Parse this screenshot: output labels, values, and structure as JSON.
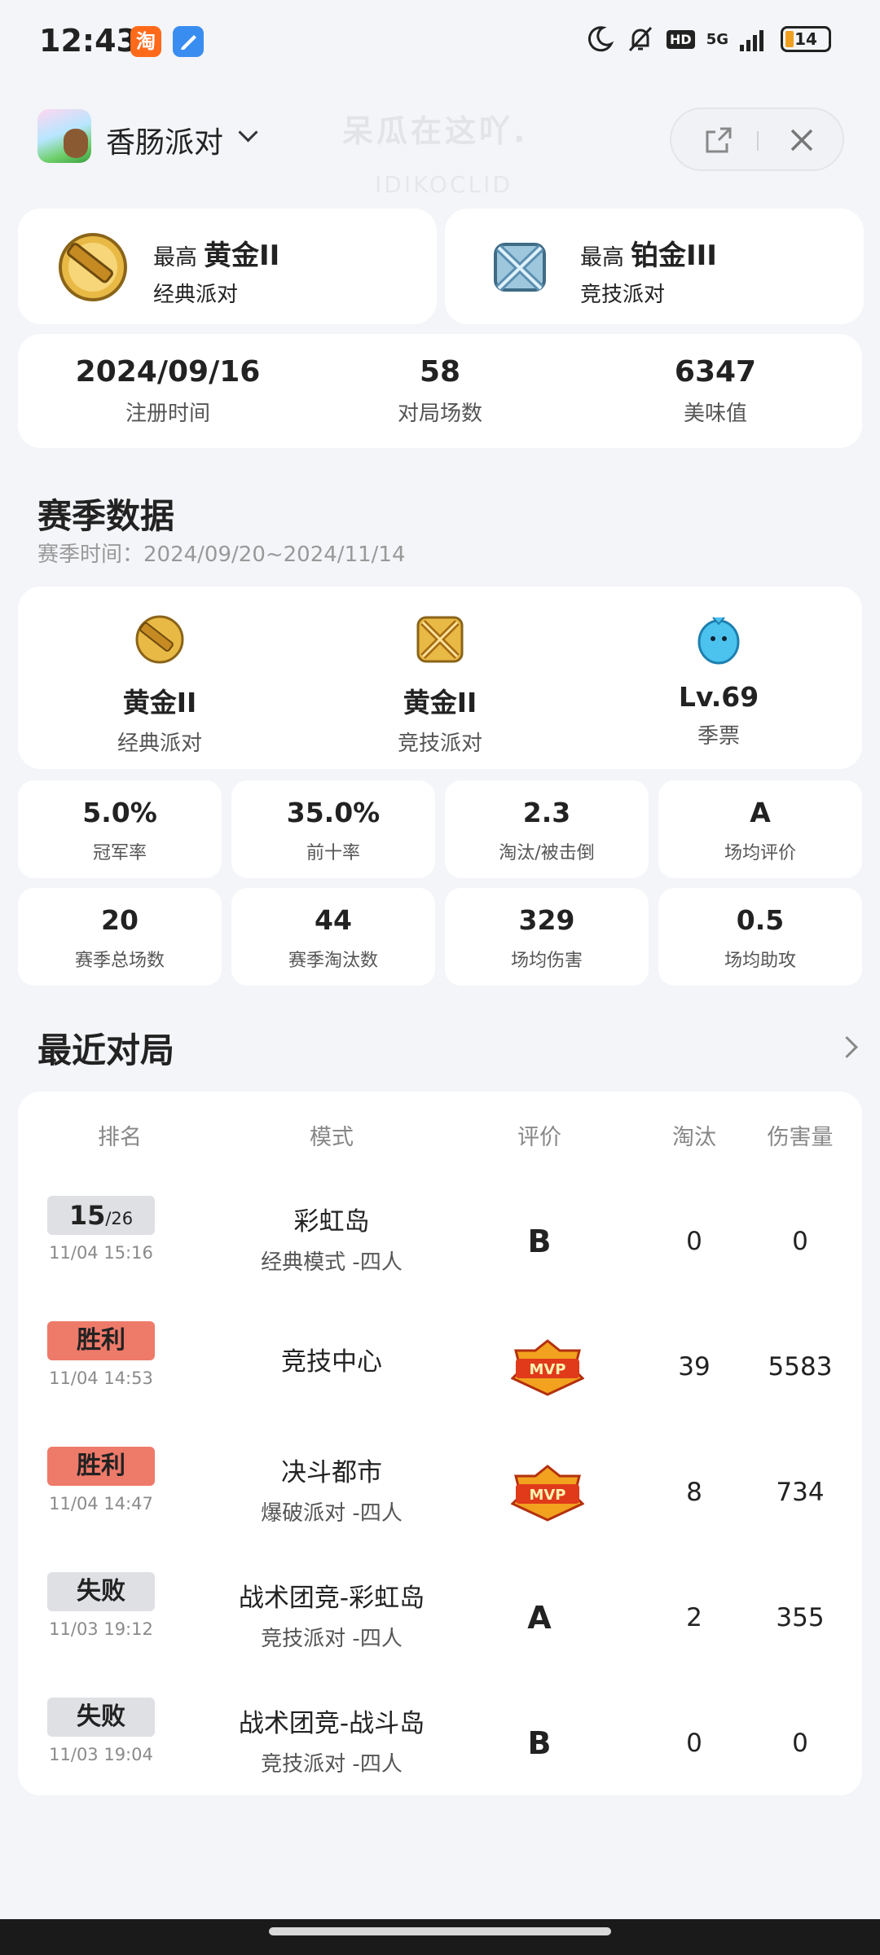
{
  "status_bar": {
    "time": "12:43",
    "app_icons": [
      "taobao-icon",
      "notes-icon"
    ],
    "taobao_glyph": "淘",
    "network": "5G",
    "hd": "HD",
    "battery": "14",
    "icons": [
      "moon-icon",
      "mute-bell-icon",
      "hd-icon",
      "signal-icon",
      "battery-icon"
    ]
  },
  "watermark": {
    "line1": "呆瓜在这吖.",
    "line2": "IDIKOCLID"
  },
  "header": {
    "game_name": "香肠派对",
    "colors": {
      "capsule_bg": "#f1f2f5"
    }
  },
  "ranks": [
    {
      "prefix": "最高",
      "tier": "黄金II",
      "mode": "经典派对",
      "medal": "gold-medal-icon"
    },
    {
      "prefix": "最高",
      "tier": "铂金III",
      "mode": "竞技派对",
      "medal": "platinum-medal-icon"
    }
  ],
  "overview": [
    {
      "value": "2024/09/16",
      "label": "注册时间"
    },
    {
      "value": "58",
      "label": "对局场数"
    },
    {
      "value": "6347",
      "label": "美味值"
    }
  ],
  "season": {
    "title": "赛季数据",
    "period": "赛季时间：2024/09/20~2024/11/14",
    "items": [
      {
        "name": "黄金II",
        "mode": "经典派对",
        "icon": "gold-medal-icon"
      },
      {
        "name": "黄金II",
        "mode": "竞技派对",
        "icon": "gold-swords-icon"
      },
      {
        "name": "Lv.69",
        "mode": "季票",
        "icon": "blue-bird-icon"
      }
    ],
    "stats": [
      {
        "value": "5.0%",
        "label": "冠军率"
      },
      {
        "value": "35.0%",
        "label": "前十率"
      },
      {
        "value": "2.3",
        "label": "淘汰/被击倒"
      },
      {
        "value": "A",
        "label": "场均评价"
      },
      {
        "value": "20",
        "label": "赛季总场数"
      },
      {
        "value": "44",
        "label": "赛季淘汰数"
      },
      {
        "value": "329",
        "label": "场均伤害"
      },
      {
        "value": "0.5",
        "label": "场均助攻"
      }
    ]
  },
  "recent": {
    "title": "最近对局",
    "headers": [
      "排名",
      "模式",
      "评价",
      "淘汰",
      "伤害量"
    ],
    "rows": [
      {
        "rank_main": "15",
        "rank_sub": "/26",
        "result": "",
        "time": "11/04 15:16",
        "mode": "彩虹岛",
        "submode": "经典模式 -四人",
        "grade": "B",
        "mvp": false,
        "kills": "0",
        "damage": "0"
      },
      {
        "rank_main": "",
        "rank_sub": "",
        "result": "胜利",
        "time": "11/04 14:53",
        "mode": "竞技中心",
        "submode": "",
        "grade": "",
        "mvp": true,
        "kills": "39",
        "damage": "5583"
      },
      {
        "rank_main": "",
        "rank_sub": "",
        "result": "胜利",
        "time": "11/04 14:47",
        "mode": "决斗都市",
        "submode": "爆破派对 -四人",
        "grade": "",
        "mvp": true,
        "kills": "8",
        "damage": "734"
      },
      {
        "rank_main": "",
        "rank_sub": "",
        "result": "失败",
        "time": "11/03 19:12",
        "mode": "战术团竞-彩虹岛",
        "submode": "竞技派对 -四人",
        "grade": "A",
        "mvp": false,
        "kills": "2",
        "damage": "355"
      },
      {
        "rank_main": "",
        "rank_sub": "",
        "result": "失败",
        "time": "11/03 19:04",
        "mode": "战术团竞-战斗岛",
        "submode": "竞技派对 -四人",
        "grade": "B",
        "mvp": false,
        "kills": "0",
        "damage": "0"
      }
    ],
    "mvp_label": "MVP",
    "colors": {
      "win": "#ee7a6a",
      "neutral": "#dfe0e4"
    }
  }
}
